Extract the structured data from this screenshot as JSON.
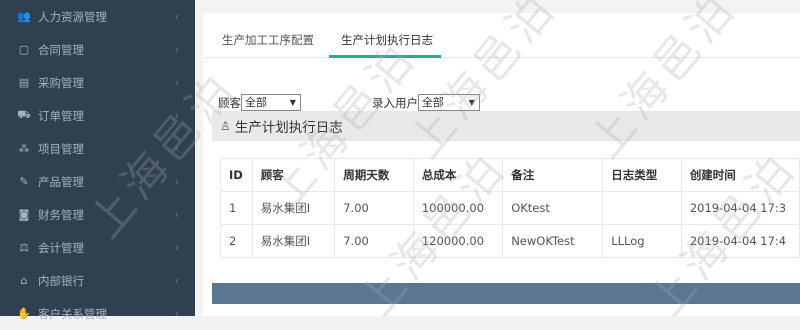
{
  "sidebar": {
    "items": [
      {
        "label": "人力资源管理",
        "icon": "users-icon",
        "glyph": "👥"
      },
      {
        "label": "合同管理",
        "icon": "document-icon",
        "glyph": "▢"
      },
      {
        "label": "采购管理",
        "icon": "list-icon",
        "glyph": "▤"
      },
      {
        "label": "订单管理",
        "icon": "cart-icon",
        "glyph": "⛟"
      },
      {
        "label": "项目管理",
        "icon": "cubes-icon",
        "glyph": "⁂"
      },
      {
        "label": "产品管理",
        "icon": "edit-icon",
        "glyph": "✎"
      },
      {
        "label": "财务管理",
        "icon": "money-icon",
        "glyph": "◙"
      },
      {
        "label": "会计管理",
        "icon": "balance-icon",
        "glyph": "⚖"
      },
      {
        "label": "内部银行",
        "icon": "bank-icon",
        "glyph": "⌂"
      },
      {
        "label": "客户关系管理",
        "icon": "handshake-icon",
        "glyph": "✋"
      }
    ]
  },
  "tabs": [
    {
      "label": "生产加工工序配置"
    },
    {
      "label": "生产计划执行日志"
    }
  ],
  "filters": {
    "customer_label": "顾客:",
    "customer_value": "全部",
    "user_label": "录入用户:",
    "user_value": "全部"
  },
  "section": {
    "title": "生产计划执行日志"
  },
  "table": {
    "headers": [
      "ID",
      "顾客",
      "周期天数",
      "总成本",
      "备注",
      "日志类型",
      "创建时间"
    ],
    "rows": [
      [
        "1",
        "易水集团I",
        "7.00",
        "100000.00",
        "OKtest",
        "",
        "2019-04-04 17:3"
      ],
      [
        "2",
        "易水集团I",
        "7.00",
        "120000.00",
        "NewOKTest",
        "LLLog",
        "2019-04-04 17:4"
      ]
    ]
  },
  "watermark": {
    "text": "上海邑泊"
  }
}
